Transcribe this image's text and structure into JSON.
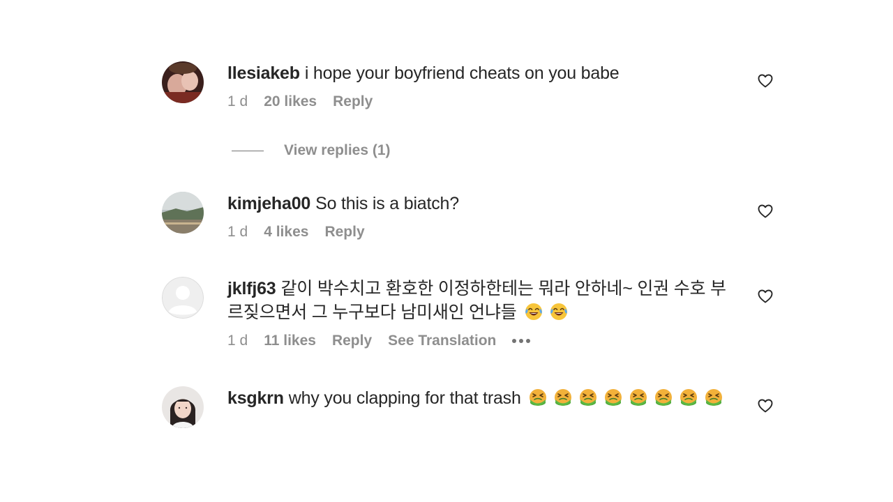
{
  "comments": [
    {
      "username": "llesiakeb",
      "text": "i hope your boyfriend cheats on you babe",
      "time": "1 d",
      "likes": "20 likes",
      "reply": "Reply",
      "view_replies": "View replies (1)"
    },
    {
      "username": "kimjeha00",
      "text": "So this is a biatch?",
      "time": "1 d",
      "likes": "4 likes",
      "reply": "Reply"
    },
    {
      "username": "jklfj63",
      "text": "같이 박수치고 환호한 이정하한테는 뭐라 안하네~ 인권 수호 부르짖으면서 그 누구보다 남미새인 언냐들",
      "text_emojis": [
        "face-with-tears-of-joy",
        "face-with-tears-of-joy"
      ],
      "time": "1 d",
      "likes": "11 likes",
      "reply": "Reply",
      "see_translation": "See Translation",
      "more_icon": "more-horizontal-icon"
    },
    {
      "username": "ksgkrn",
      "text": "why you clapping for that trash",
      "text_emojis": [
        "nauseated-face",
        "nauseated-face",
        "nauseated-face",
        "nauseated-face",
        "nauseated-face",
        "nauseated-face",
        "nauseated-face",
        "nauseated-face"
      ]
    }
  ],
  "icons": {
    "like": "heart-outline-icon"
  },
  "colors": {
    "text": "#262626",
    "secondary": "#8e8e8e",
    "background": "#ffffff"
  }
}
